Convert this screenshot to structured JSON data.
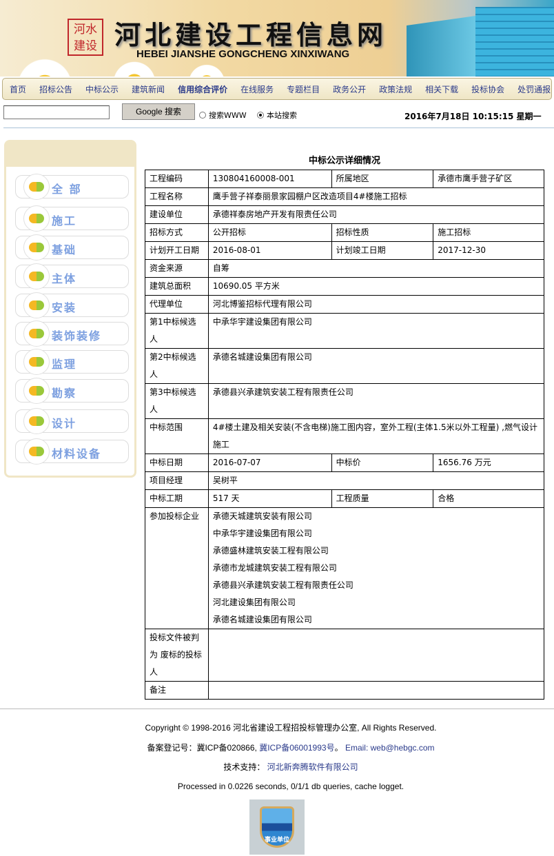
{
  "banner": {
    "seal": "河水建设",
    "title": "河北建设工程信息网",
    "subtitle": "HEBEI JIANSHE GONGCHENG XINXIWANG"
  },
  "nav": [
    "首页",
    "招标公告",
    "中标公示",
    "建筑新闻",
    "信用综合评价",
    "在线服务",
    "专题栏目",
    "政务公开",
    "政策法规",
    "相关下载",
    "投标协会",
    "处罚通报"
  ],
  "search": {
    "value": "",
    "button": "Google 搜索",
    "opt1": "搜索WWW",
    "opt2": "本站搜索",
    "selected": "本站搜索",
    "datetime": "2016年7月18日  10:15:15 星期一"
  },
  "sidebar": [
    "全 部",
    "施工",
    "基础",
    "主体",
    "安装",
    "装饰装修",
    "监理",
    "勘察",
    "设计",
    "材料设备"
  ],
  "detail": {
    "title": "中标公示详细情况",
    "rows": [
      [
        "工程编码",
        "130804160008-001",
        "所属地区",
        "承德市鹰手营子矿区"
      ],
      [
        "工程名称",
        "鹰手营子祥泰丽景家园棚户区改造项目4#楼施工招标"
      ],
      [
        "建设单位",
        "承德祥泰房地产开发有限责任公司"
      ],
      [
        "招标方式",
        "公开招标",
        "招标性质",
        "施工招标"
      ],
      [
        "计划开工日期",
        "2016-08-01",
        "计划竣工日期",
        "2017-12-30"
      ],
      [
        "资金来源",
        "自筹"
      ],
      [
        "建筑总面积",
        "10690.05 平方米"
      ],
      [
        "代理单位",
        "河北博鉴招标代理有限公司"
      ],
      [
        "第1中标候选人",
        "中承华宇建设集团有限公司"
      ],
      [
        "第2中标候选人",
        "承德名城建设集团有限公司"
      ],
      [
        "第3中标候选人",
        "承德县兴承建筑安装工程有限责任公司"
      ],
      [
        "中标范围",
        "4#楼土建及相关安装(不含电梯)施工图内容，室外工程(主体1.5米以外工程量) ,燃气设计施工"
      ],
      [
        "中标日期",
        "2016-07-07",
        "中标价",
        "1656.76 万元"
      ],
      [
        "项目经理",
        "吴树平"
      ],
      [
        "中标工期",
        "517 天",
        "工程质量",
        "合格"
      ],
      [
        "参加投标企业",
        "承德天城建筑安装有限公司\n中承华宇建设集团有限公司\n承德盛林建筑安装工程有限公司\n承德市龙城建筑安装工程有限公司\n承德县兴承建筑安装工程有限责任公司\n河北建设集团有限公司\n承德名城建设集团有限公司"
      ],
      [
        "投标文件被判为 废标的投标人",
        ""
      ],
      [
        "备注",
        ""
      ]
    ]
  },
  "footer": {
    "copyright": "Copyright © 1998-2016 河北省建设工程招投标管理办公室, All Rights Reserved.",
    "icp_label": "备案登记号：冀ICP备020866, ",
    "icp_link": "冀ICP备06001993号",
    "icp_end": "。 ",
    "email": "Email: web@hebgc.com",
    "support_label": "技术支持： ",
    "support_link": "河北新奔腾软件有限公司",
    "processed": "Processed in 0.0226 seconds, 0/1/1 db queries, cache logget.",
    "badge": "事业单位"
  },
  "colors": {
    "nav_link": "#2a3a8a",
    "sidebar_label": "#7da0e0"
  }
}
